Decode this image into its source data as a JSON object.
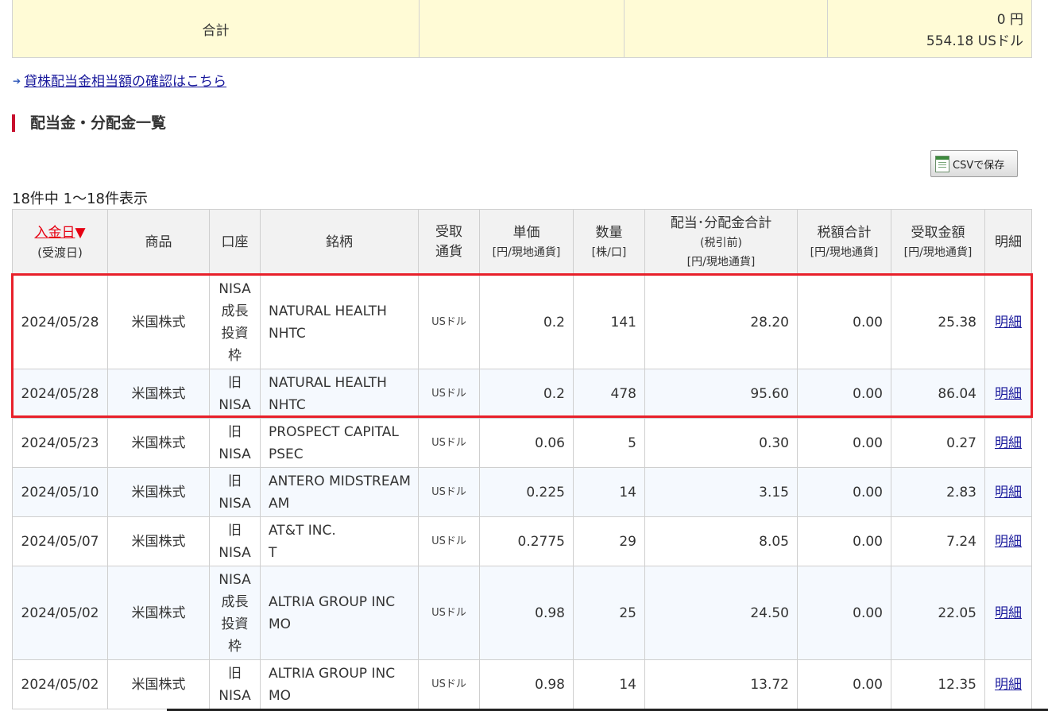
{
  "summary": {
    "label": "合計",
    "amount_yen": "0 円",
    "amount_usd": "554.18 USドル"
  },
  "lending_link": "貸株配当金相当額の確認はこちら",
  "section_title": "配当金・分配金一覧",
  "csv_button": "CSVで保存",
  "count_text": "18件中 1〜18件表示",
  "headers": {
    "date": "入金日",
    "date_sort": "▼",
    "date_sub": "(受渡日)",
    "product": "商品",
    "account": "口座",
    "stock": "銘柄",
    "currency_1": "受取",
    "currency_2": "通貨",
    "unit_price": "単価",
    "unit_price_sub": "[円/現地通貨]",
    "quantity": "数量",
    "quantity_sub": "[株/口]",
    "total": "配当･分配金合計",
    "total_sub1": "(税引前)",
    "total_sub2": "[円/現地通貨]",
    "tax": "税額合計",
    "tax_sub": "[円/現地通貨]",
    "received": "受取金額",
    "received_sub": "[円/現地通貨]",
    "detail": "明細"
  },
  "rows": [
    {
      "date": "2024/05/28",
      "product": "米国株式",
      "account": [
        "NISA",
        "成長",
        "投資",
        "枠"
      ],
      "name": "NATURAL HEALTH",
      "ticker": "NHTC",
      "currency": "USドル",
      "unit_price": "0.2",
      "quantity": "141",
      "total": "28.20",
      "tax": "0.00",
      "received": "25.38",
      "detail": "明細"
    },
    {
      "date": "2024/05/28",
      "product": "米国株式",
      "account": [
        "旧",
        "NISA"
      ],
      "name": "NATURAL HEALTH",
      "ticker": "NHTC",
      "currency": "USドル",
      "unit_price": "0.2",
      "quantity": "478",
      "total": "95.60",
      "tax": "0.00",
      "received": "86.04",
      "detail": "明細"
    },
    {
      "date": "2024/05/23",
      "product": "米国株式",
      "account": [
        "旧",
        "NISA"
      ],
      "name": "PROSPECT CAPITAL",
      "ticker": "PSEC",
      "currency": "USドル",
      "unit_price": "0.06",
      "quantity": "5",
      "total": "0.30",
      "tax": "0.00",
      "received": "0.27",
      "detail": "明細"
    },
    {
      "date": "2024/05/10",
      "product": "米国株式",
      "account": [
        "旧",
        "NISA"
      ],
      "name": "ANTERO MIDSTREAM",
      "ticker": "AM",
      "currency": "USドル",
      "unit_price": "0.225",
      "quantity": "14",
      "total": "3.15",
      "tax": "0.00",
      "received": "2.83",
      "detail": "明細"
    },
    {
      "date": "2024/05/07",
      "product": "米国株式",
      "account": [
        "旧",
        "NISA"
      ],
      "name": "AT&T INC.",
      "ticker": "T",
      "currency": "USドル",
      "unit_price": "0.2775",
      "quantity": "29",
      "total": "8.05",
      "tax": "0.00",
      "received": "7.24",
      "detail": "明細"
    },
    {
      "date": "2024/05/02",
      "product": "米国株式",
      "account": [
        "NISA",
        "成長",
        "投資",
        "枠"
      ],
      "name": "ALTRIA GROUP INC",
      "ticker": "MO",
      "currency": "USドル",
      "unit_price": "0.98",
      "quantity": "25",
      "total": "24.50",
      "tax": "0.00",
      "received": "22.05",
      "detail": "明細"
    },
    {
      "date": "2024/05/02",
      "product": "米国株式",
      "account": [
        "旧",
        "NISA"
      ],
      "name": "ALTRIA GROUP INC",
      "ticker": "MO",
      "currency": "USドル",
      "unit_price": "0.98",
      "quantity": "14",
      "total": "13.72",
      "tax": "0.00",
      "received": "12.35",
      "detail": "明細"
    }
  ],
  "colors": {
    "summary_bg": "#fffbd6",
    "header_bg": "#f2f2f2",
    "stripe_bg": "#f5f9fe",
    "accent_red": "#e60012",
    "highlight_border": "#e8202a",
    "link_blue": "#1a1a9c"
  }
}
